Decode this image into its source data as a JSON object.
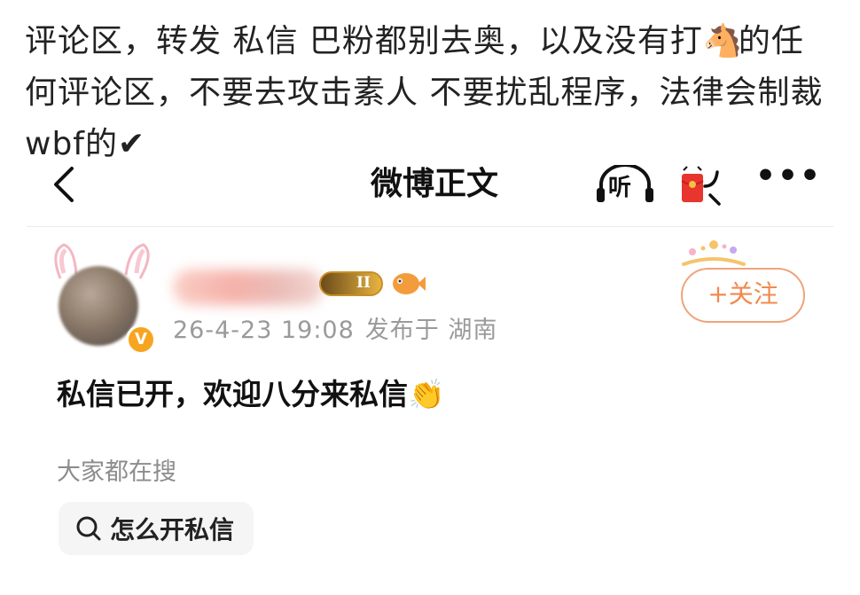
{
  "caption": {
    "line1": "评论区，转发 私信 巴粉都别去奥，以及没有打",
    "horse_emoji": "🐴",
    "line1_end": "的任",
    "line2": "何评论区，不要去攻击素人 不要扰乱程序，法律会制裁",
    "line3": "wbf的",
    "check_mark": "✔"
  },
  "navbar": {
    "title": "微博正文",
    "listen_label": "听",
    "more_label": "•••"
  },
  "post": {
    "level_badge": "II",
    "timestamp": "26-4-23 19:08",
    "location": "发布于 湖南",
    "follow_label": "+关注",
    "content": "私信已开，欢迎八分来私信",
    "clap_emoji": "👏"
  },
  "search": {
    "label": "大家都在搜",
    "chip_text": "怎么开私信"
  },
  "colors": {
    "accent_orange": "#f08a4e",
    "verified_badge": "#f7a520",
    "meta_gray": "#9a9a9a"
  }
}
